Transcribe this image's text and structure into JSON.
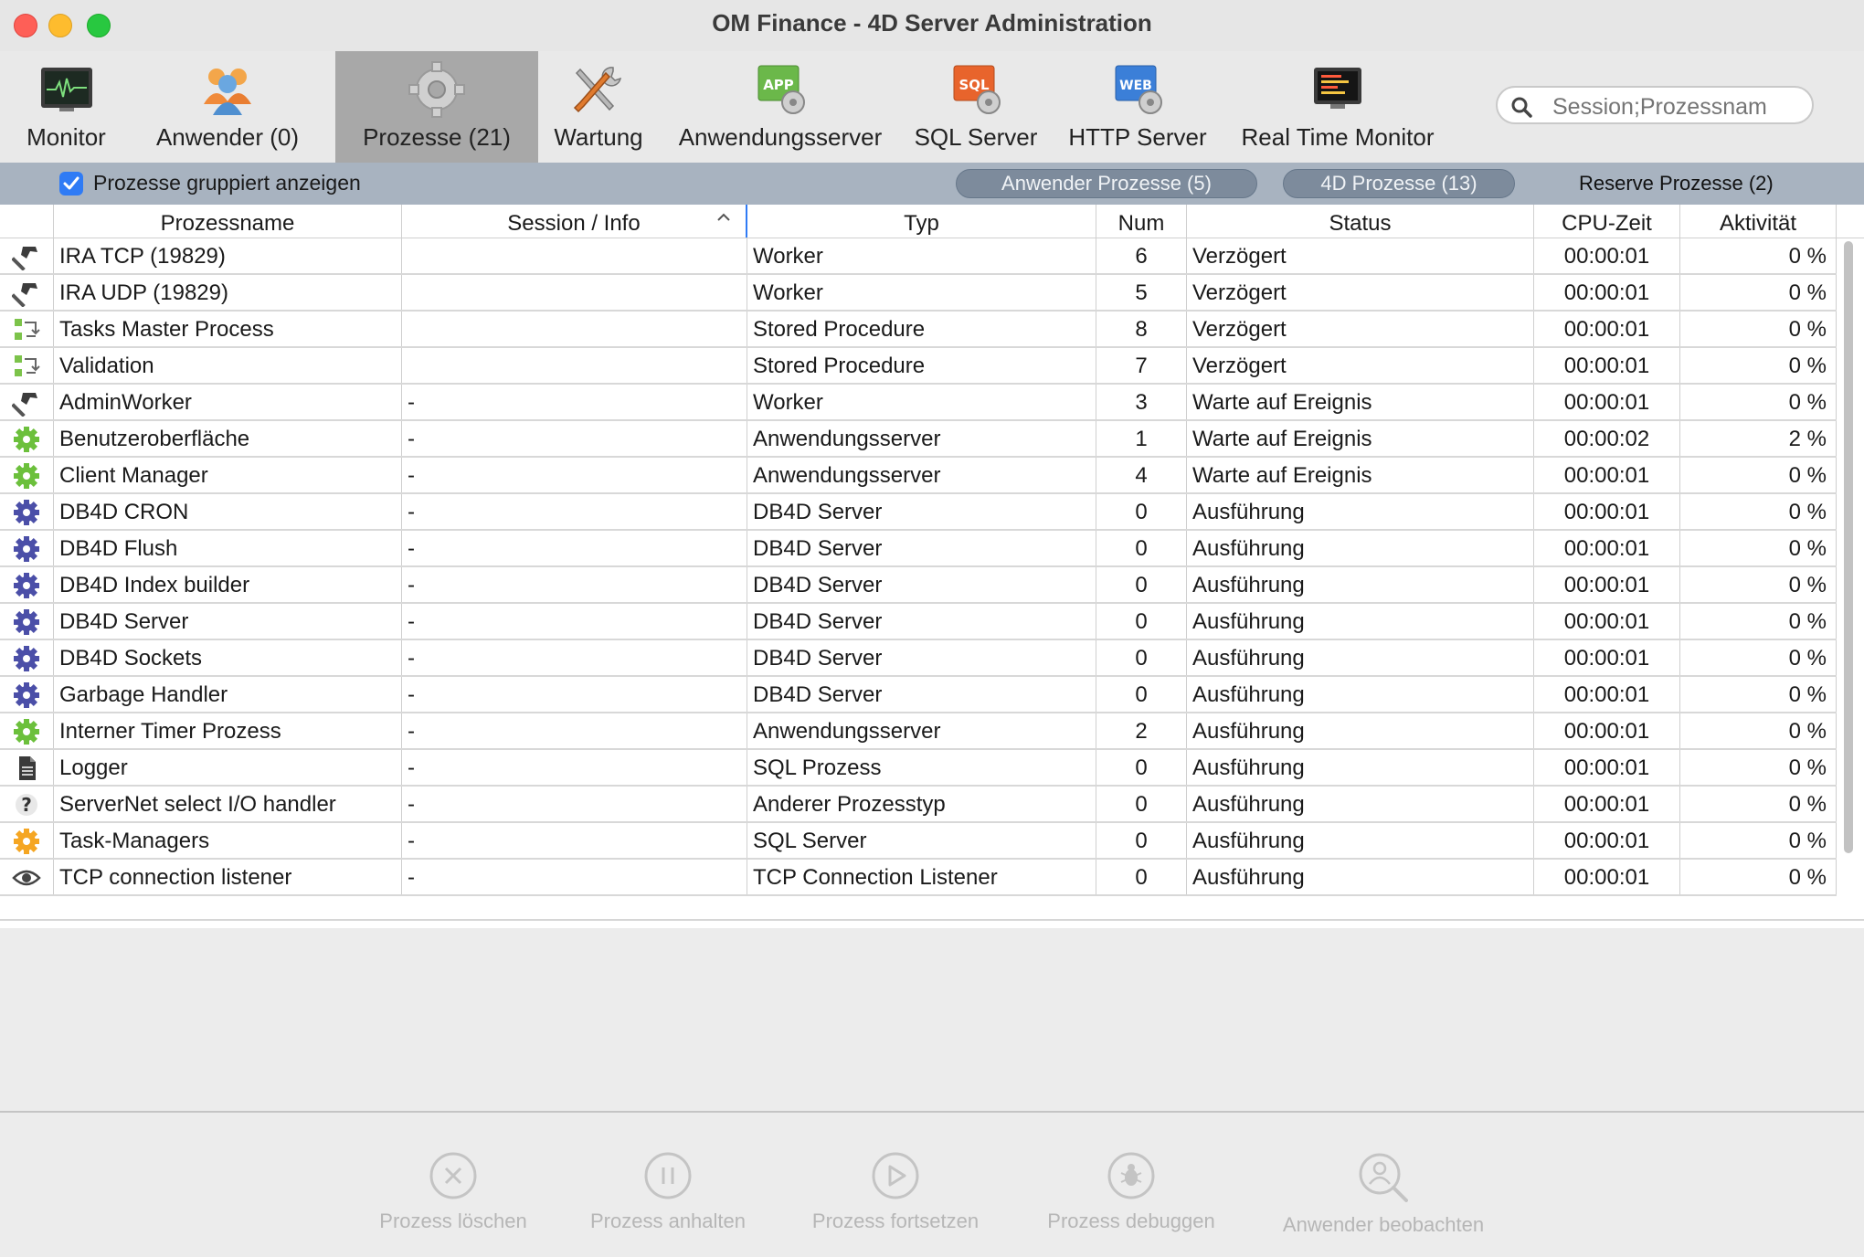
{
  "window": {
    "title": "OM Finance - 4D Server Administration"
  },
  "toolbar": {
    "tabs": [
      {
        "label": "Monitor",
        "icon": "monitor-icon"
      },
      {
        "label": "Anwender (0)",
        "icon": "users-icon"
      },
      {
        "label": "Prozesse (21)",
        "icon": "gear-icon",
        "active": true
      },
      {
        "label": "Wartung",
        "icon": "tools-icon"
      },
      {
        "label": "Anwendungsserver",
        "icon": "app-server-icon"
      },
      {
        "label": "SQL Server",
        "icon": "sql-server-icon"
      },
      {
        "label": "HTTP Server",
        "icon": "web-server-icon"
      },
      {
        "label": "Real Time Monitor",
        "icon": "realtime-monitor-icon"
      }
    ],
    "app_badge": "APP",
    "sql_badge": "SQL",
    "web_badge": "WEB",
    "search": {
      "placeholder": "Session;Prozessnam",
      "value": ""
    }
  },
  "groupbar": {
    "checkbox_label": "Prozesse gruppiert anzeigen",
    "checkbox_checked": true,
    "user_processes": "Anwender Prozesse (5)",
    "fourd_processes": "4D Prozesse (13)",
    "reserve_processes": "Reserve Prozesse (2)"
  },
  "table": {
    "headers": {
      "name": "Prozessname",
      "session": "Session / Info",
      "type": "Typ",
      "num": "Num",
      "status": "Status",
      "cpu": "CPU-Zeit",
      "activity": "Aktivität"
    },
    "rows": [
      {
        "icon": "hammer-icon",
        "name": "IRA TCP (19829)",
        "session": "",
        "type": "Worker",
        "num": "6",
        "status": "Verzögert",
        "cpu": "00:00:01",
        "activity": "0 %"
      },
      {
        "icon": "hammer-icon",
        "name": "IRA UDP (19829)",
        "session": "",
        "type": "Worker",
        "num": "5",
        "status": "Verzögert",
        "cpu": "00:00:01",
        "activity": "0 %"
      },
      {
        "icon": "stored-procedure-icon",
        "name": "Tasks Master Process",
        "session": "",
        "type": "Stored Procedure",
        "num": "8",
        "status": "Verzögert",
        "cpu": "00:00:01",
        "activity": "0 %"
      },
      {
        "icon": "stored-procedure-icon",
        "name": "Validation",
        "session": "",
        "type": "Stored Procedure",
        "num": "7",
        "status": "Verzögert",
        "cpu": "00:00:01",
        "activity": "0 %"
      },
      {
        "icon": "hammer-icon",
        "name": "AdminWorker",
        "session": "-",
        "type": "Worker",
        "num": "3",
        "status": "Warte auf Ereignis",
        "cpu": "00:00:01",
        "activity": "0 %"
      },
      {
        "icon": "green-gear-icon",
        "name": "Benutzeroberfläche",
        "session": "-",
        "type": "Anwendungsserver",
        "num": "1",
        "status": "Warte auf Ereignis",
        "cpu": "00:00:02",
        "activity": "2 %"
      },
      {
        "icon": "green-gear-icon",
        "name": "Client Manager",
        "session": "-",
        "type": "Anwendungsserver",
        "num": "4",
        "status": "Warte auf Ereignis",
        "cpu": "00:00:01",
        "activity": "0 %"
      },
      {
        "icon": "blue-gear-icon",
        "name": "DB4D CRON",
        "session": "-",
        "type": "DB4D Server",
        "num": "0",
        "status": "Ausführung",
        "cpu": "00:00:01",
        "activity": "0 %"
      },
      {
        "icon": "blue-gear-icon",
        "name": "DB4D Flush",
        "session": "-",
        "type": "DB4D Server",
        "num": "0",
        "status": "Ausführung",
        "cpu": "00:00:01",
        "activity": "0 %"
      },
      {
        "icon": "blue-gear-icon",
        "name": "DB4D Index builder",
        "session": "-",
        "type": "DB4D Server",
        "num": "0",
        "status": "Ausführung",
        "cpu": "00:00:01",
        "activity": "0 %"
      },
      {
        "icon": "blue-gear-icon",
        "name": "DB4D Server",
        "session": "-",
        "type": "DB4D Server",
        "num": "0",
        "status": "Ausführung",
        "cpu": "00:00:01",
        "activity": "0 %"
      },
      {
        "icon": "blue-gear-icon",
        "name": "DB4D Sockets",
        "session": "-",
        "type": "DB4D Server",
        "num": "0",
        "status": "Ausführung",
        "cpu": "00:00:01",
        "activity": "0 %"
      },
      {
        "icon": "blue-gear-icon",
        "name": "Garbage Handler",
        "session": "-",
        "type": "DB4D Server",
        "num": "0",
        "status": "Ausführung",
        "cpu": "00:00:01",
        "activity": "0 %"
      },
      {
        "icon": "green-gear-icon",
        "name": "Interner Timer Prozess",
        "session": "-",
        "type": "Anwendungsserver",
        "num": "2",
        "status": "Ausführung",
        "cpu": "00:00:01",
        "activity": "0 %"
      },
      {
        "icon": "document-icon",
        "name": "Logger",
        "session": "-",
        "type": "SQL Prozess",
        "num": "0",
        "status": "Ausführung",
        "cpu": "00:00:01",
        "activity": "0 %"
      },
      {
        "icon": "question-icon",
        "name": "ServerNet select I/O handler",
        "session": "-",
        "type": "Anderer Prozesstyp",
        "num": "0",
        "status": "Ausführung",
        "cpu": "00:00:01",
        "activity": "0 %"
      },
      {
        "icon": "orange-gear-icon",
        "name": "Task-Managers",
        "session": "-",
        "type": "SQL Server",
        "num": "0",
        "status": "Ausführung",
        "cpu": "00:00:01",
        "activity": "0 %"
      },
      {
        "icon": "eye-icon",
        "name": "TCP connection listener",
        "session": "-",
        "type": "TCP Connection Listener",
        "num": "0",
        "status": "Ausführung",
        "cpu": "00:00:01",
        "activity": "0 %"
      }
    ]
  },
  "actions": [
    {
      "label": "Prozess löschen",
      "icon": "delete-process-icon"
    },
    {
      "label": "Prozess anhalten",
      "icon": "pause-process-icon"
    },
    {
      "label": "Prozess fortsetzen",
      "icon": "resume-process-icon"
    },
    {
      "label": "Prozess debuggen",
      "icon": "debug-process-icon"
    },
    {
      "label": "Anwender beobachten",
      "icon": "watch-user-icon"
    }
  ],
  "colors": {
    "groupbar_bg": "#a8b3c0",
    "active_tab": "#a8a8a8",
    "checkbox": "#2f7bf5",
    "green_gear": "#6cc03c",
    "blue_gear": "#4b4fa8",
    "orange_gear": "#f5a623",
    "disabled_text": "#b6b6b6"
  }
}
